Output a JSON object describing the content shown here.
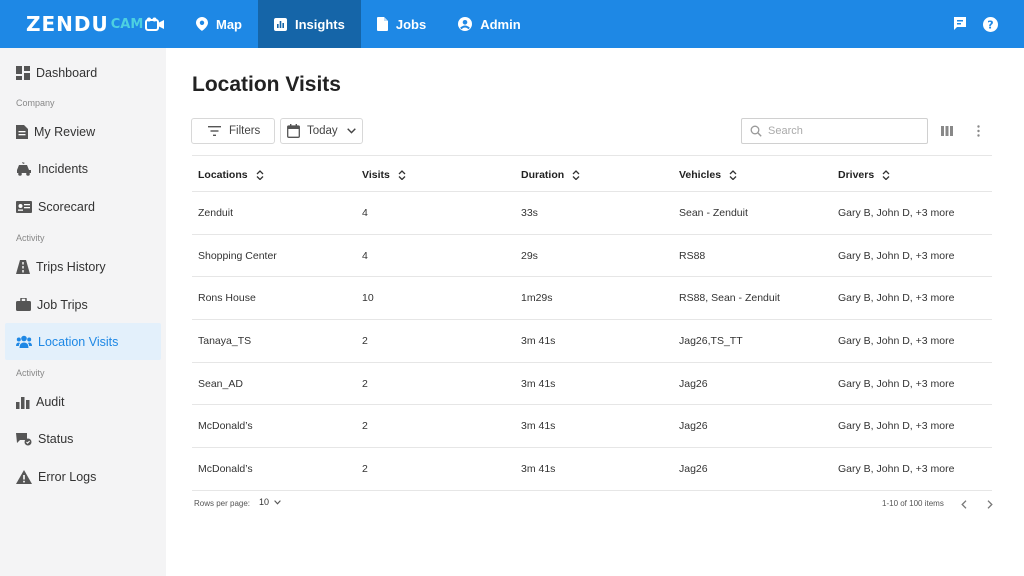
{
  "app": {
    "logo_text": "ZENDU",
    "logo_sub": "CAM"
  },
  "nav": {
    "items": [
      {
        "label": "Map",
        "icon": "map-pin-icon"
      },
      {
        "label": "Insights",
        "icon": "chart-icon",
        "active": true
      },
      {
        "label": "Jobs",
        "icon": "document-icon"
      },
      {
        "label": "Admin",
        "icon": "user-circle-icon"
      }
    ],
    "right_icons": [
      "flag-icon",
      "help-icon"
    ]
  },
  "sidebar": {
    "items": [
      {
        "label": "Dashboard",
        "icon": "dashboard-icon"
      },
      {
        "label": "My Review",
        "icon": "review-icon"
      },
      {
        "label": "Incidents",
        "icon": "incident-icon"
      },
      {
        "label": "Scorecard",
        "icon": "scorecard-icon"
      },
      {
        "label": "Trips History",
        "icon": "road-icon"
      },
      {
        "label": "Job Trips",
        "icon": "briefcase-icon"
      },
      {
        "label": "Location Visits",
        "icon": "users-icon",
        "active": true
      },
      {
        "label": "Audit",
        "icon": "bar-chart-icon"
      },
      {
        "label": "Status",
        "icon": "status-icon"
      },
      {
        "label": "Error Logs",
        "icon": "warning-icon"
      }
    ],
    "sections": [
      "Company",
      "Activity",
      "Activity"
    ]
  },
  "main": {
    "title": "Location Visits",
    "filters_label": "Filters",
    "date_label": "Today",
    "search_placeholder": "Search"
  },
  "table": {
    "columns": [
      "Locations",
      "Visits",
      "Duration",
      "Vehicles",
      "Drivers"
    ],
    "rows": [
      [
        "Zenduit",
        "4",
        "33s",
        "Sean - Zenduit",
        "Gary B, John D, +3 more"
      ],
      [
        "Shopping Center",
        "4",
        "29s",
        "RS88",
        "Gary B, John D, +3 more"
      ],
      [
        "Rons House",
        "10",
        "1m29s",
        "RS88, Sean - Zenduit",
        "Gary B, John D, +3 more"
      ],
      [
        "Tanaya_TS",
        "2",
        "3m 41s",
        "Jag26,TS_TT",
        "Gary B, John D, +3 more"
      ],
      [
        "Sean_AD",
        "2",
        "3m 41s",
        "Jag26",
        "Gary B, John D, +3 more"
      ],
      [
        "McDonald’s",
        "2",
        "3m 41s",
        "Jag26",
        "Gary B, John D, +3 more"
      ],
      [
        "McDonald’s",
        "2",
        "3m 41s",
        "Jag26",
        "Gary B, John D, +3 more"
      ]
    ]
  },
  "footer": {
    "rows_per_page_label": "Rows per page:",
    "rows_per_page_value": "10",
    "range_text": "1-10 of 100 items"
  },
  "colors": {
    "brand_blue": "#1e88e5",
    "nav_active": "#1565a8",
    "logo_accent": "#4dd0e1",
    "sidebar_bg": "#f4f4f5",
    "sidebar_active_bg": "#e3f0fb"
  }
}
